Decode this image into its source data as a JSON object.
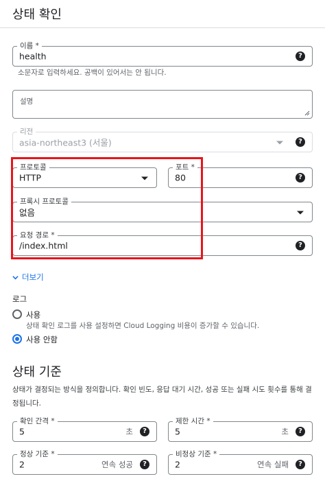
{
  "header": {
    "title": "상태 확인"
  },
  "name_field": {
    "label": "이름 *",
    "value": "health",
    "hint": "소문자로 입력하세요. 공백이 있어서는 안 됩니다."
  },
  "description_field": {
    "label": "설명",
    "value": ""
  },
  "region_field": {
    "label": "리전",
    "value": "asia-northeast3 (서울)"
  },
  "protocol_field": {
    "label": "프로토콜",
    "value": "HTTP"
  },
  "port_field": {
    "label": "포트 *",
    "value": "80"
  },
  "proxy_protocol_field": {
    "label": "프록시 프로토콜",
    "value": "없음"
  },
  "request_path_field": {
    "label": "요청 경로 *",
    "value": "/index.html"
  },
  "more": {
    "label": "더보기"
  },
  "logs": {
    "title": "로그",
    "on_label": "사용",
    "on_description": "상태 확인 로그를 사용 설정하면 Cloud Logging 비용이 증가할 수 있습니다.",
    "off_label": "사용 안함",
    "selected": "off"
  },
  "criteria": {
    "title": "상태 기준",
    "description": "상태가 결정되는 방식을 정의합니다. 확인 빈도, 응답 대기 시간, 성공 또는 실패 시도 횟수를 통해 결정됩니다.",
    "check_interval": {
      "label": "확인 간격 *",
      "value": "5",
      "unit": "초"
    },
    "timeout": {
      "label": "제한 시간 *",
      "value": "5",
      "unit": "초"
    },
    "healthy_threshold": {
      "label": "정상 기준 *",
      "value": "2",
      "unit": "연속 성공"
    },
    "unhealthy_threshold": {
      "label": "비정상 기준 *",
      "value": "2",
      "unit": "연속 실패"
    }
  },
  "help_glyph": "?",
  "colors": {
    "accent": "#1a73e8",
    "highlight": "#e8141a",
    "text": "#202124"
  }
}
